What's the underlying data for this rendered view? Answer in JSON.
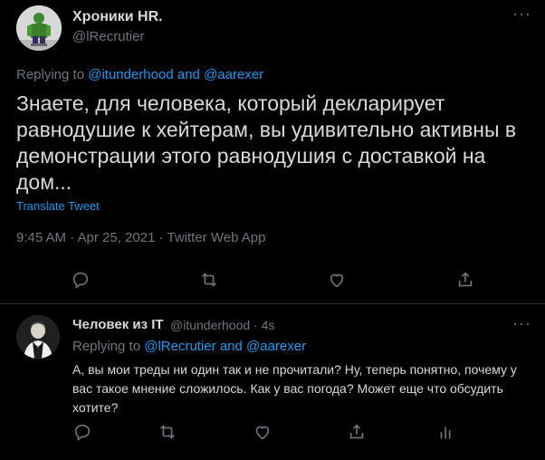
{
  "main_tweet": {
    "author_name": "Хроники HR.",
    "handle": "@lRecrutier",
    "replying_prefix": "Replying to",
    "replying_user1": "@itunderhood",
    "replying_and": "and",
    "replying_user2": "@aarexer",
    "text": "Знаете, для человека, который декларирует равнодушие к хейтерам, вы удивительно активны в демонстрации этого равнодушия с доставкой на дом...",
    "translate": "Translate Tweet",
    "meta": "9:45 AM · Apr 25, 2021 · Twitter Web App",
    "more": "···"
  },
  "reply_tweet": {
    "author_name": "Человек из IT",
    "handle_time": "@itunderhood · 4s",
    "replying_prefix": "Replying to",
    "replying_user1": "@lRecrutier",
    "replying_and": "and",
    "replying_user2": "@aarexer",
    "text": "А, вы мои треды ни один так и не прочитали? Ну, теперь понятно, почему у вас такое мнение сложилось. Как у вас погода? Может еще что обсудить хотите?",
    "more": "···"
  },
  "colors": {
    "background": "#000000",
    "text": "#d9d9d9",
    "muted": "#6e767d",
    "link": "#1d9bf0",
    "divider": "#2f3336"
  },
  "icons": [
    "reply-icon",
    "retweet-icon",
    "like-icon",
    "share-icon",
    "analytics-icon",
    "more-icon"
  ]
}
